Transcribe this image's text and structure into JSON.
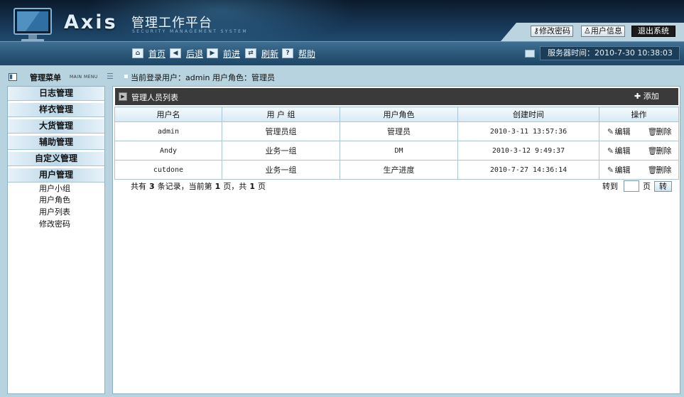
{
  "header": {
    "brand": "Axis",
    "platform_title": "管理工作平台",
    "subtitle": "SECURITY MANAGEMENT SYSTEM",
    "buttons": {
      "change_password": "修改密码",
      "user_info": "用户信息",
      "logout": "退出系统"
    }
  },
  "toolbar": {
    "home": "首页",
    "back": "后退",
    "forward": "前进",
    "refresh": "刷新",
    "help": "帮助",
    "icons": [
      "home-icon",
      "back-icon",
      "forward-icon",
      "refresh-icon",
      "help-icon"
    ],
    "server_time_label": "服务器时间：",
    "server_time_value": "2010-7-30 10:38:03"
  },
  "sidebar": {
    "title": "管理菜单",
    "subtitle": "MAIN MENU",
    "sections": [
      {
        "label": "日志管理"
      },
      {
        "label": "样衣管理"
      },
      {
        "label": "大货管理"
      },
      {
        "label": "辅助管理"
      },
      {
        "label": "自定义管理"
      },
      {
        "label": "用户管理",
        "expanded": true
      }
    ],
    "user_mgmt_items": [
      {
        "label": "用户小组"
      },
      {
        "label": "用户角色"
      },
      {
        "label": "用户列表"
      },
      {
        "label": "修改密码"
      }
    ]
  },
  "main": {
    "login_info": "当前登录用户：admin  用户角色：管理员",
    "list_title": "管理人员列表",
    "add_label": "添加",
    "table": {
      "columns": [
        "用户名",
        "用 户 组",
        "用户角色",
        "创建时间",
        "操作"
      ],
      "rows": [
        {
          "username": "admin",
          "group": "管理员组",
          "role": "管理员",
          "created": "2010-3-11 13:57:36"
        },
        {
          "username": "Andy",
          "group": "业务一组",
          "role": "DM",
          "created": "2010-3-12 9:49:37"
        },
        {
          "username": "cutdone",
          "group": "业务一组",
          "role": "生产进度",
          "created": "2010-7-27 14:36:14"
        }
      ],
      "edit_label": "编辑",
      "delete_label": "删除"
    },
    "pager": {
      "text_total_prefix": "共有",
      "total_records": "3",
      "text_records_mid": "条记录，当前第",
      "current_page": "1",
      "text_page_mid": "页，共",
      "total_pages": "1",
      "text_page_suffix": "页",
      "goto_label": "转到",
      "goto_value": "",
      "goto_unit": "页",
      "goto_button": "转"
    }
  },
  "colors": {
    "header_dark": "#0b1a2b",
    "toolbar_blue": "#2a5677",
    "frame_bg": "#b7d3df",
    "list_bar": "#3a3a3a",
    "table_border": "#a9c5d6"
  }
}
